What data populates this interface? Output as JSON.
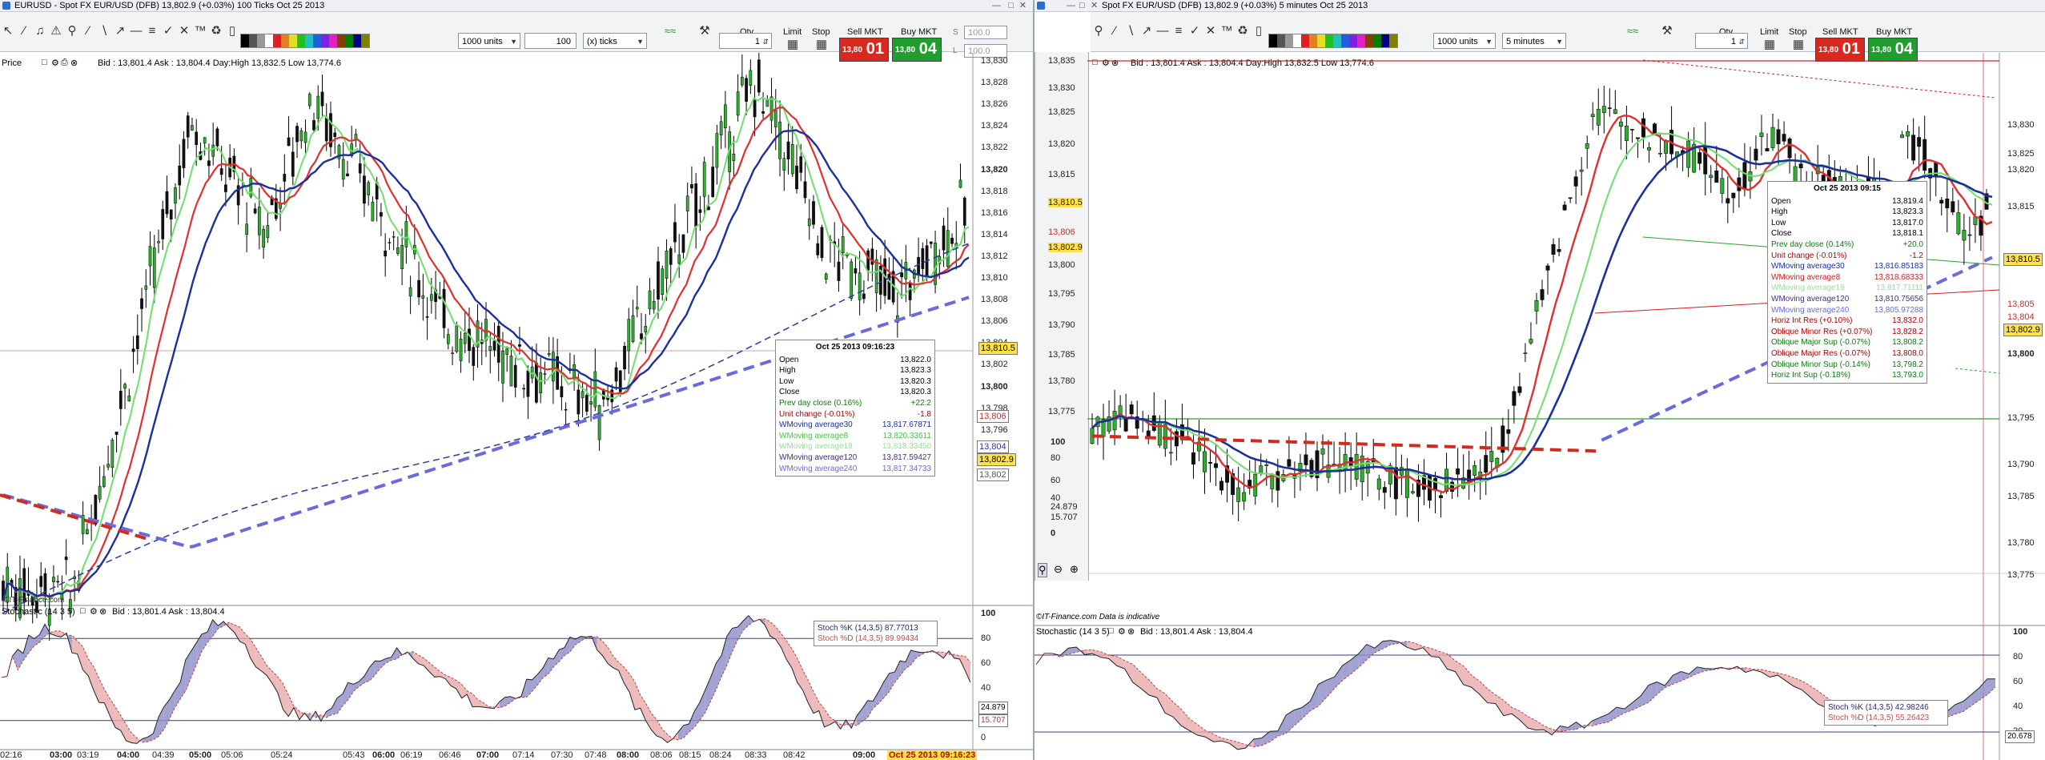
{
  "left": {
    "title": "EURUSD - Spot FX EUR/USD (DFB)    13,802.9 (+0.03%)    100 Ticks  Oct 25 2013",
    "units": "1000 units",
    "ticks_value": "100",
    "ticks_mode": "(x) ticks",
    "qty_label": "Qty",
    "qty_value": "1",
    "limit_label": "Limit",
    "stop_label": "Stop",
    "sell_label": "Sell MKT",
    "buy_label": "Buy MKT",
    "sell_small": "13,80",
    "sell_big": "01",
    "buy_small": "13,80",
    "buy_big": "04",
    "s_label": "S",
    "l_label": "L",
    "s_value": "100.0",
    "l_value": "100.0",
    "price_panel_label": "Price",
    "price_info": "Bid : 13,801.4  Ask : 13,804.4  Day:High 13,832.5 Low 13,774.6",
    "price_axis": [
      "13,830",
      "13,828",
      "13,826",
      "13,824",
      "13,822",
      "13,820",
      "13,818",
      "13,816",
      "13,814",
      "13,812",
      "13,810",
      "13,808",
      "13,806",
      "13,804",
      "13,802",
      "13,800",
      "13,798",
      "13,796",
      "13,794"
    ],
    "badge_current": "13,810.5",
    "badge_last": "13,802.9",
    "badge_a": "13,806",
    "badge_b": "13,804",
    "badge_c": "13,802",
    "tooltip": {
      "header": "Oct 25 2013 09:16:23",
      "rows": [
        {
          "k": "Open",
          "v": "13,822.0",
          "c": "#000000"
        },
        {
          "k": "High",
          "v": "13,823.3",
          "c": "#000000"
        },
        {
          "k": "Low",
          "v": "13,820.3",
          "c": "#000000"
        },
        {
          "k": "Close",
          "v": "13,820.3",
          "c": "#000000"
        },
        {
          "k": "Prev day close (0.16%)",
          "v": "+22.2",
          "c": "#0a7d0a"
        },
        {
          "k": "Unit change (-0.01%)",
          "v": "-1.8",
          "c": "#b00000"
        },
        {
          "k": "WMoving average30",
          "v": "13,817.67871",
          "c": "#1c2f9e"
        },
        {
          "k": "WMoving average8",
          "v": "13,820.33611",
          "c": "#45c845"
        },
        {
          "k": "WMoving average18",
          "v": "13,818.33450",
          "c": "#96e296"
        },
        {
          "k": "WMoving average120",
          "v": "13,817.59427",
          "c": "#4b2a8a"
        },
        {
          "k": "WMoving average240",
          "v": "13,817.34733",
          "c": "#6a6adf"
        }
      ]
    },
    "stoch_label": "Stochastic (14 3 5)",
    "stoch_info": "Bid : 13,801.4  Ask : 13,804.4",
    "stoch_k": "Stoch %K (14,3,5)  87.77013",
    "stoch_d": "Stoch %D (14,3,5)  89.99434",
    "stoch_axis": [
      "100",
      "80",
      "60",
      "40",
      "20",
      "0"
    ],
    "stoch_badge1": "24.879",
    "stoch_badge2": "15.707",
    "time_axis": [
      "02:16",
      "03:00",
      "03:19",
      "04:00",
      "04:39",
      "05:00",
      "05:06",
      "05:24",
      "05:43",
      "06:00",
      "06:19",
      "06:46",
      "07:00",
      "07:14",
      "07:30",
      "07:48",
      "08:00",
      "08:06",
      "08:15",
      "08:24",
      "08:33",
      "08:42",
      "09:00"
    ],
    "time_highlight": "Oct 25 2013 09:16:23",
    "watermark": "©IT-Finance.com"
  },
  "right": {
    "title": "Spot FX EUR/USD (DFB)    13,802.9 (+0.03%)    5 minutes  Oct 25 2013",
    "units": "1000 units",
    "interval": "5 minutes",
    "qty_label": "Qty",
    "qty_value": "1",
    "limit_label": "Limit",
    "stop_label": "Stop",
    "sell_label": "Sell MKT",
    "buy_label": "Buy MKT",
    "sell_small": "13,80",
    "sell_big": "01",
    "buy_small": "13,80",
    "buy_big": "04",
    "price_info": "Bid : 13,801.4  Ask : 13,804.4  Day:High 13,832.5 Low 13,774.6",
    "left_axis": [
      "13,835",
      "13,830",
      "13,825",
      "13,820",
      "13,815",
      "13,810.5",
      "13,806",
      "13,802.9",
      "13,800",
      "13,795",
      "13,790",
      "13,785",
      "13,780",
      "13,775"
    ],
    "right_axis": [
      "13,830",
      "13,825",
      "13,820",
      "13,815",
      "13,810.5",
      "13,805",
      "13,804",
      "13,802.9",
      "13,800",
      "13,795",
      "13,790",
      "13,785",
      "13,780",
      "13,775"
    ],
    "mini_axis": [
      "100",
      "80",
      "60",
      "40",
      "24.879",
      "15.707",
      "0"
    ],
    "tooltip": {
      "header": "Oct 25 2013 09:15",
      "rows": [
        {
          "k": "Open",
          "v": "13,819.4",
          "c": "#000000"
        },
        {
          "k": "High",
          "v": "13,823.3",
          "c": "#000000"
        },
        {
          "k": "Low",
          "v": "13,817.0",
          "c": "#000000"
        },
        {
          "k": "Close",
          "v": "13,818.1",
          "c": "#000000"
        },
        {
          "k": "Prev day close (0.14%)",
          "v": "+20.0",
          "c": "#0a7d0a"
        },
        {
          "k": "Unit change (-0.01%)",
          "v": "-1.2",
          "c": "#b00000"
        },
        {
          "k": "WMoving average30",
          "v": "13,816.85183",
          "c": "#1c2f9e"
        },
        {
          "k": "WMoving average8",
          "v": "13,818.68333",
          "c": "#d02020"
        },
        {
          "k": "WMoving average18",
          "v": "13,817.71111",
          "c": "#96e296"
        },
        {
          "k": "WMoving average120",
          "v": "13,810.75656",
          "c": "#4b2a8a"
        },
        {
          "k": "WMoving average240",
          "v": "13,805.97288",
          "c": "#6a6adf"
        },
        {
          "k": "Horiz Int Res (+0.10%)",
          "v": "13,832.0",
          "c": "#b00000"
        },
        {
          "k": "Oblique Minor Res (+0.07%)",
          "v": "13,828.2",
          "c": "#b00000"
        },
        {
          "k": "Oblique Major Sup (-0.07%)",
          "v": "13,808.2",
          "c": "#0a7d0a"
        },
        {
          "k": "Oblique Major Res (-0.07%)",
          "v": "13,808.0",
          "c": "#b00000"
        },
        {
          "k": "Oblique Minor Sup (-0.14%)",
          "v": "13,798.2",
          "c": "#0a7d0a"
        },
        {
          "k": "Horiz Int Sup (-0.18%)",
          "v": "13,793.0",
          "c": "#0a7d0a"
        }
      ]
    },
    "watermark": "©IT-Finance.com  Data is indicative",
    "stoch_label": "Stochastic (14 3 5)",
    "stoch_info": "Bid : 13,801.4  Ask : 13,804.4",
    "stoch_k": "Stoch %K (14,3,5)  42.98246",
    "stoch_d": "Stoch %D (14,3,5)  55.26423",
    "stoch_axis": [
      "100",
      "80",
      "60",
      "40",
      "20"
    ],
    "stoch_badge": "20.678",
    "badge_current": "13,810.5",
    "badge_last": "13,802.9"
  },
  "colors": {
    "sell": "#d9281e",
    "buy": "#1f9e2f",
    "ma30": "#1c2f9e",
    "ma8_left": "#45c845",
    "ma18": "#96e296",
    "ma120": "#5b5bdf",
    "ma240": "#d42a1e",
    "stoch_k_fill": "#8c8cc8",
    "stoch_d_fill": "#e8aaaa"
  }
}
